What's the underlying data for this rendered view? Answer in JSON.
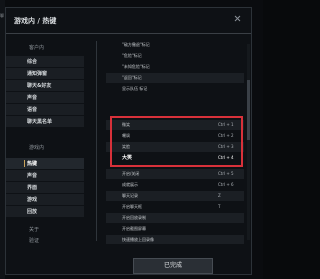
{
  "edge_text": "聊",
  "title": "游戏内 / 热键",
  "sidebar": {
    "header_out": "客户内",
    "items_out": [
      {
        "label": "综合"
      },
      {
        "label": "通知弹窗"
      },
      {
        "label": "聊天&好友"
      },
      {
        "label": "声音"
      },
      {
        "label": "语音"
      },
      {
        "label": "聊天黑名单"
      }
    ],
    "header_in": "游戏内",
    "items_in": [
      {
        "label": "热键",
        "active": true
      },
      {
        "label": "声音"
      },
      {
        "label": "界面"
      },
      {
        "label": "游戏"
      },
      {
        "label": "回放"
      }
    ],
    "header_about": "关于",
    "items_about": [
      {
        "label": "验证"
      }
    ]
  },
  "hotkeys": [
    {
      "name": "\"敌方撤退\"标记",
      "key": ""
    },
    {
      "name": "\"危险\"标记",
      "key": ""
    },
    {
      "name": "\"未知危险\"标记",
      "key": ""
    },
    {
      "name": "\"返回\"标记",
      "key": ""
    },
    {
      "name": "显示队伍 标记",
      "key": ""
    },
    {
      "name": "微笑",
      "key": "Ctrl + 1"
    },
    {
      "name": "嘲讽",
      "key": "Ctrl + 2"
    },
    {
      "name": "笑脸",
      "key": "Ctrl + 3"
    },
    {
      "name": "大笑",
      "key": "Ctrl + 4",
      "bold": true
    },
    {
      "name": "开启/关闭",
      "key": "Ctrl + 5"
    },
    {
      "name": "成就展示",
      "key": "Ctrl + 6"
    },
    {
      "name": "聊天记录",
      "key": "Z"
    },
    {
      "name": "开启聊天框",
      "key": "T"
    },
    {
      "name": "开启回放录制",
      "key": ""
    },
    {
      "name": "开启截图屏幕",
      "key": ""
    },
    {
      "name": "快速播放上回录像",
      "key": ""
    }
  ],
  "done_label": "已完成",
  "colors": {
    "highlight": "#d8313a",
    "active_marker": "#c9a25a"
  }
}
